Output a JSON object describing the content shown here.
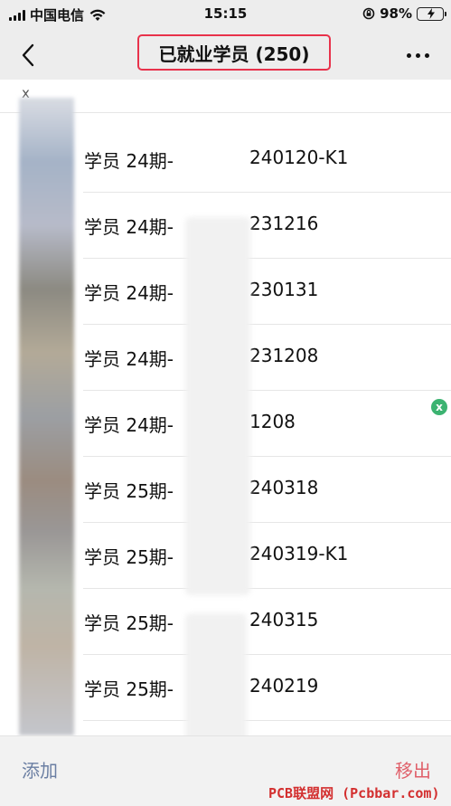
{
  "status_bar": {
    "carrier": "中国电信",
    "time": "15:15",
    "battery": "98%",
    "battery_level": 0.98
  },
  "nav": {
    "title": "已就业学员 (250)"
  },
  "top_row": {
    "close_mark": "x"
  },
  "members": [
    {
      "name": "学员 24期-",
      "suffix": "240120-K1"
    },
    {
      "name": "学员 24期-",
      "suffix": "231216"
    },
    {
      "name": "学员 24期-",
      "suffix": "230131"
    },
    {
      "name": "学员 24期-",
      "suffix": "231208"
    },
    {
      "name": "学员 24期-",
      "suffix": "1208"
    },
    {
      "name": "学员 25期-",
      "suffix": "240318"
    },
    {
      "name": "学员 25期-",
      "suffix": "240319-K1"
    },
    {
      "name": "学员 25期-",
      "suffix": "240315"
    },
    {
      "name": "学员 25期-",
      "suffix": "240219"
    }
  ],
  "badge": {
    "label": "x"
  },
  "bottom_bar": {
    "add_label": "添加",
    "remove_label": "移出"
  },
  "watermark": "PCB联盟网 (Pcbbar.com)",
  "colors": {
    "header_bg": "#ededed",
    "title_outline": "#e8324b",
    "add_text": "#6b7fa3",
    "remove_text": "#e0606a",
    "badge_green": "#3cb371"
  }
}
